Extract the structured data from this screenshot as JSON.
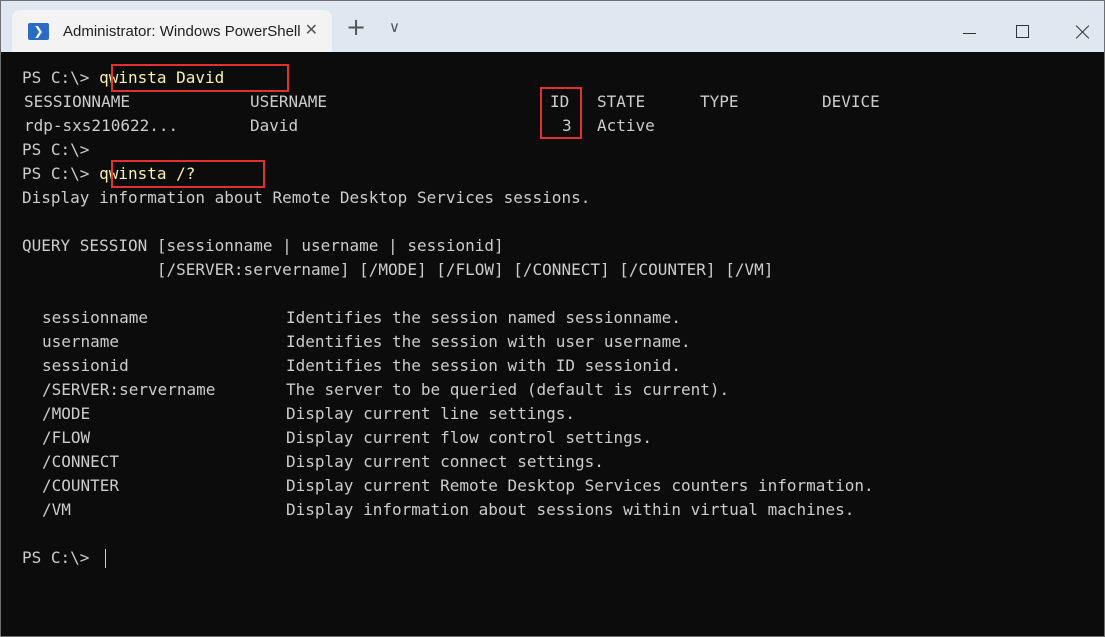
{
  "window": {
    "tab_title": "Administrator: Windows PowerShell",
    "tab_icon": "powershell-icon",
    "tab_icon_glyph": "❯",
    "close_tab_glyph": "✕",
    "new_tab_glyph": "+",
    "dropdown_glyph": "∨"
  },
  "terminal": {
    "prompt": "PS C:\\>",
    "cmd1": "qwinsta David",
    "header_row": {
      "sessionname": "SESSIONNAME",
      "username": "USERNAME",
      "id": "ID",
      "state": "STATE",
      "type": "TYPE",
      "device": "DEVICE"
    },
    "session_row": {
      "sessionname": "rdp-sxs210622...",
      "username": "David",
      "id": "3",
      "state": "Active"
    },
    "cmd2": "qwinsta /?",
    "description": "Display information about Remote Desktop Services sessions.",
    "syntax": [
      "QUERY SESSION [sessionname | username | sessionid]",
      "              [/SERVER:servername] [/MODE] [/FLOW] [/CONNECT] [/COUNTER] [/VM]"
    ],
    "params": [
      {
        "name": "sessionname",
        "desc": "Identifies the session named sessionname."
      },
      {
        "name": "username",
        "desc": "Identifies the session with user username."
      },
      {
        "name": "sessionid",
        "desc": "Identifies the session with ID sessionid."
      },
      {
        "name": "/SERVER:servername",
        "desc": "The server to be queried (default is current)."
      },
      {
        "name": "/MODE",
        "desc": "Display current line settings."
      },
      {
        "name": "/FLOW",
        "desc": "Display current flow control settings."
      },
      {
        "name": "/CONNECT",
        "desc": "Display current connect settings."
      },
      {
        "name": "/COUNTER",
        "desc": "Display current Remote Desktop Services counters information."
      },
      {
        "name": "/VM",
        "desc": "Display information about sessions within virtual machines."
      }
    ]
  },
  "colors": {
    "background": "#0c0c0c",
    "foreground": "#cccccc",
    "command": "#f9f1a5",
    "highlight_box": "#e03030",
    "titlebar": "#dfe7f1"
  }
}
